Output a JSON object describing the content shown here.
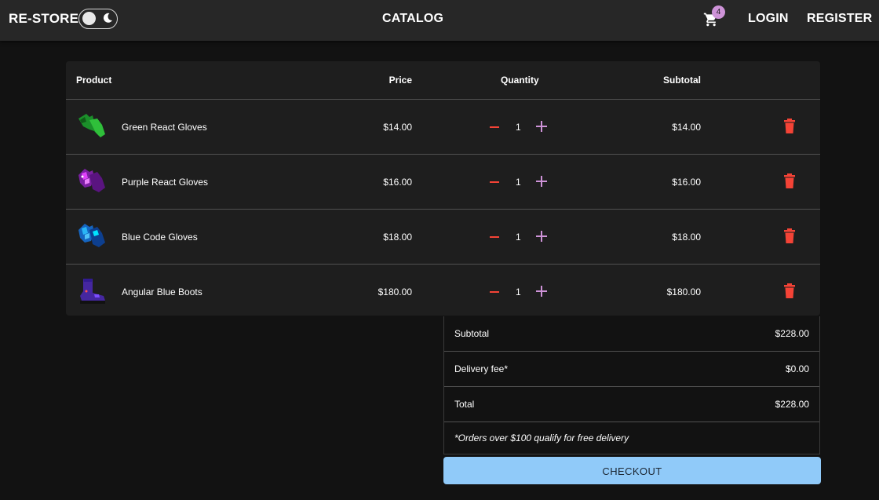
{
  "header": {
    "brand": "RE-STORE",
    "center_link": "CATALOG",
    "cart_count": "4",
    "login": "LOGIN",
    "register": "REGISTER"
  },
  "table": {
    "headers": {
      "product": "Product",
      "price": "Price",
      "quantity": "Quantity",
      "subtotal": "Subtotal"
    },
    "rows": [
      {
        "name": "Green React Gloves",
        "price": "$14.00",
        "qty": "1",
        "subtotal": "$14.00",
        "icon": "green-gloves-icon"
      },
      {
        "name": "Purple React Gloves",
        "price": "$16.00",
        "qty": "1",
        "subtotal": "$16.00",
        "icon": "purple-gloves-icon"
      },
      {
        "name": "Blue Code Gloves",
        "price": "$18.00",
        "qty": "1",
        "subtotal": "$18.00",
        "icon": "blue-gloves-icon"
      },
      {
        "name": "Angular Blue Boots",
        "price": "$180.00",
        "qty": "1",
        "subtotal": "$180.00",
        "icon": "blue-boots-icon"
      }
    ]
  },
  "summary": {
    "subtotal_label": "Subtotal",
    "subtotal_value": "$228.00",
    "delivery_label": "Delivery fee*",
    "delivery_value": "$0.00",
    "total_label": "Total",
    "total_value": "$228.00",
    "note": "*Orders over $100 qualify for free delivery"
  },
  "checkout_label": "CHECKOUT",
  "colors": {
    "appbar": "#272727",
    "background": "#121212",
    "table": "#1e1e1e",
    "minus": "#f44336",
    "plus": "#ce93d8",
    "trash": "#f44336",
    "checkout": "#90caf9",
    "badge": "#ce93d8"
  }
}
